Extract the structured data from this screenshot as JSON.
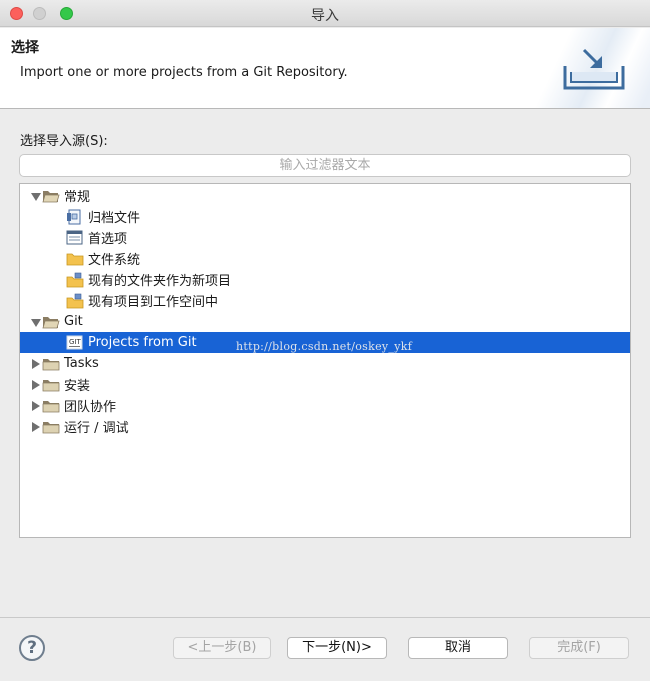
{
  "window": {
    "title": "导入"
  },
  "banner": {
    "title": "选择",
    "description": "Import one or more projects from a Git Repository."
  },
  "source": {
    "label": "选择导入源(S):",
    "filter_placeholder": "输入过滤器文本",
    "filter_value": ""
  },
  "tree": {
    "items": [
      {
        "label": "常规",
        "expanded": true,
        "icon": "folder-open-icon"
      },
      {
        "label": "归档文件",
        "icon": "archive-file-icon"
      },
      {
        "label": "首选项",
        "icon": "preferences-icon"
      },
      {
        "label": "文件系统",
        "icon": "folder-icon"
      },
      {
        "label": "现有的文件夹作为新项目",
        "icon": "folder-project-icon"
      },
      {
        "label": "现有项目到工作空间中",
        "icon": "existing-project-icon"
      },
      {
        "label": "Git",
        "expanded": true,
        "icon": "folder-open-icon"
      },
      {
        "label": "Projects from Git",
        "icon": "git-repo-icon",
        "selected": true
      },
      {
        "label": "Tasks",
        "expanded": false,
        "icon": "folder-closed-icon"
      },
      {
        "label": "安装",
        "expanded": false,
        "icon": "folder-closed-icon"
      },
      {
        "label": "团队协作",
        "expanded": false,
        "icon": "folder-closed-icon"
      },
      {
        "label": "运行 / 调试",
        "expanded": false,
        "icon": "folder-closed-icon"
      }
    ]
  },
  "watermark": "http://blog.csdn.net/oskey_ykf",
  "footer": {
    "help": "?",
    "back_label": "<上一步(B)",
    "next_label": "下一步(N)>",
    "cancel_label": "取消",
    "finish_label": "完成(F)"
  },
  "colors": {
    "selection": "#1863d5",
    "close": "#fc605c",
    "maximize": "#34c84a"
  }
}
